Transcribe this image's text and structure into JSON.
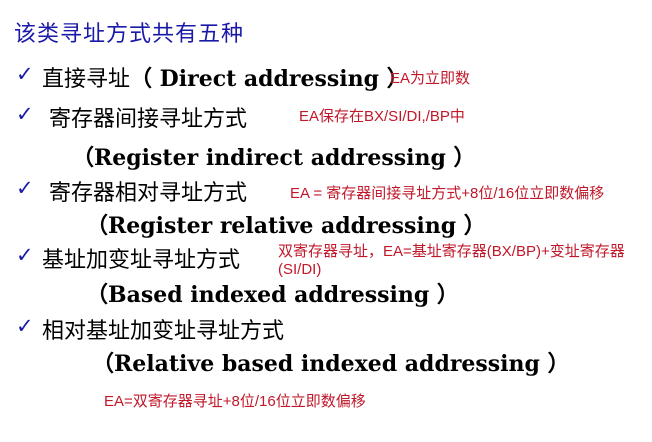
{
  "title": "该类寻址方式共有五种",
  "check_mark": "✓",
  "items": [
    {
      "cn": "直接寻址",
      "en": "（ Direct addressing ）",
      "note": "EA为立即数"
    },
    {
      "cn": "寄存器间接寻址方式",
      "note": "EA保存在BX/SI/DI,/BP中",
      "en": "（Register indirect addressing ）"
    },
    {
      "cn": "寄存器相对寻址方式",
      "note": "EA = 寄存器间接寻址方式+8位/16位立即数偏移",
      "en": "（Register relative addressing ）"
    },
    {
      "cn": "基址加变址寻址方式",
      "note": "双寄存器寻址，EA=基址寄存器(BX/BP)+变址寄存器(SI/DI)",
      "en": "（Based indexed addressing ）"
    },
    {
      "cn": "相对基址加变址寻址方式",
      "en": "（Relative based indexed addressing ）",
      "note": "EA=双寄存器寻址+8位/16位立即数偏移"
    }
  ],
  "colors": {
    "title": "#1a1aa8",
    "check": "#1a1aa8",
    "note": "#c0182a",
    "text": "#000000"
  }
}
